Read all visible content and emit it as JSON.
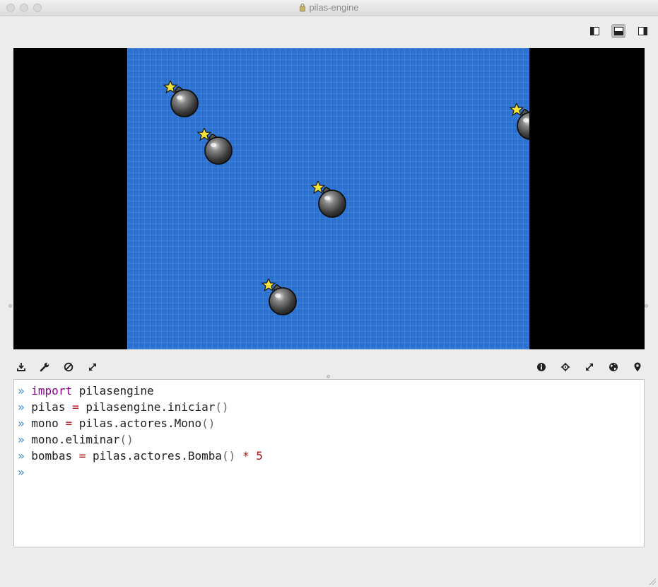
{
  "window": {
    "title": "pilas-engine"
  },
  "layout_buttons": [
    {
      "name": "layout-left-panel-button",
      "icon": "sidebar-left-icon",
      "active": false
    },
    {
      "name": "layout-bottom-panel-button",
      "icon": "panel-bottom-icon",
      "active": true
    },
    {
      "name": "layout-right-panel-button",
      "icon": "sidebar-right-icon",
      "active": false
    }
  ],
  "game": {
    "background_color": "#2a71d2",
    "actors": [
      "Bomba",
      "Bomba",
      "Bomba",
      "Bomba",
      "Bomba"
    ]
  },
  "toolbar_left": [
    "save-icon",
    "wrench-icon",
    "forbidden-icon",
    "expand-icon"
  ],
  "toolbar_right": [
    "info-icon",
    "move-icon",
    "expand-icon",
    "globe-icon",
    "location-pin-icon"
  ],
  "console": {
    "prompt": "»",
    "lines": [
      {
        "kw": "import",
        "rest": " pilasengine"
      },
      {
        "a": "pilas",
        "op": "=",
        "b": "pilasengine.iniciar",
        "p": "()"
      },
      {
        "a": "mono",
        "op": "=",
        "b": "pilas.actores.Mono",
        "p": "()"
      },
      {
        "b": "mono.eliminar",
        "p": "()"
      },
      {
        "a": "bombas",
        "op": "=",
        "b": "pilas.actores.Bomba",
        "p": "()",
        "op2": "*",
        "num": "5"
      }
    ]
  }
}
